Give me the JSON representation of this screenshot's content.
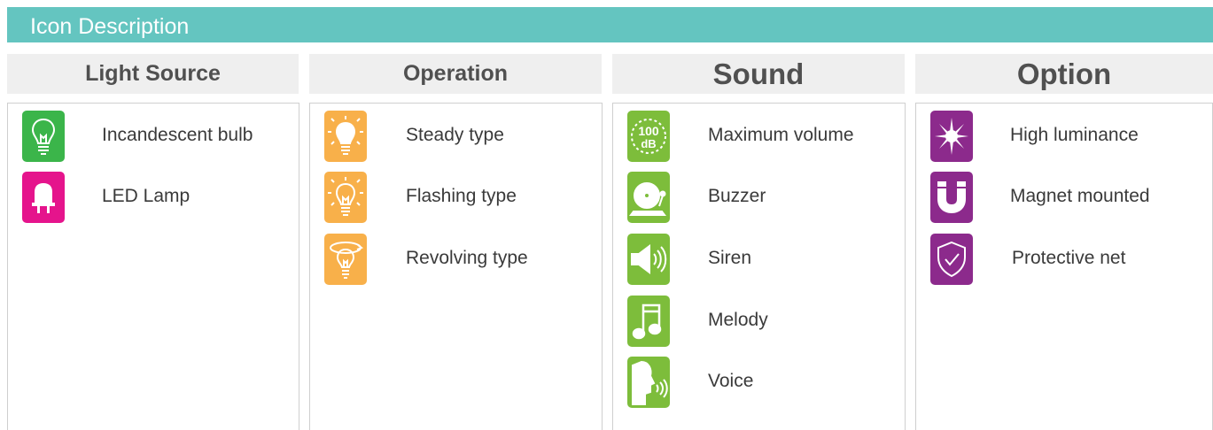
{
  "header": {
    "title": "Icon Description"
  },
  "columns": [
    {
      "heading": "Light Source",
      "items": [
        {
          "label": "Incandescent bulb",
          "icon": "incandescent-bulb-icon",
          "color": "#3bb54a"
        },
        {
          "label": "LED Lamp",
          "icon": "led-lamp-icon",
          "color": "#e5148c"
        }
      ]
    },
    {
      "heading": "Operation",
      "items": [
        {
          "label": "Steady type",
          "icon": "steady-bulb-icon",
          "color": "#f8b04a"
        },
        {
          "label": "Flashing type",
          "icon": "flashing-bulb-icon",
          "color": "#f8b04a"
        },
        {
          "label": "Revolving type",
          "icon": "revolving-bulb-icon",
          "color": "#f8b04a"
        }
      ]
    },
    {
      "heading": "Sound",
      "items": [
        {
          "label": "Maximum volume",
          "icon": "volume-100db-icon",
          "color": "#7dbd3b",
          "icon_text_top": "100",
          "icon_text_bottom": "dB"
        },
        {
          "label": "Buzzer",
          "icon": "buzzer-icon",
          "color": "#7dbd3b"
        },
        {
          "label": "Siren",
          "icon": "speaker-icon",
          "color": "#7dbd3b"
        },
        {
          "label": "Melody",
          "icon": "music-note-icon",
          "color": "#7dbd3b"
        },
        {
          "label": "Voice",
          "icon": "voice-icon",
          "color": "#7dbd3b"
        }
      ]
    },
    {
      "heading": "Option",
      "items": [
        {
          "label": "High luminance",
          "icon": "high-luminance-icon",
          "color": "#8c2a8c"
        },
        {
          "label": "Magnet mounted",
          "icon": "magnet-icon",
          "color": "#8c2a8c"
        },
        {
          "label": "Protective net",
          "icon": "shield-check-icon",
          "color": "#8c2a8c"
        }
      ]
    }
  ]
}
